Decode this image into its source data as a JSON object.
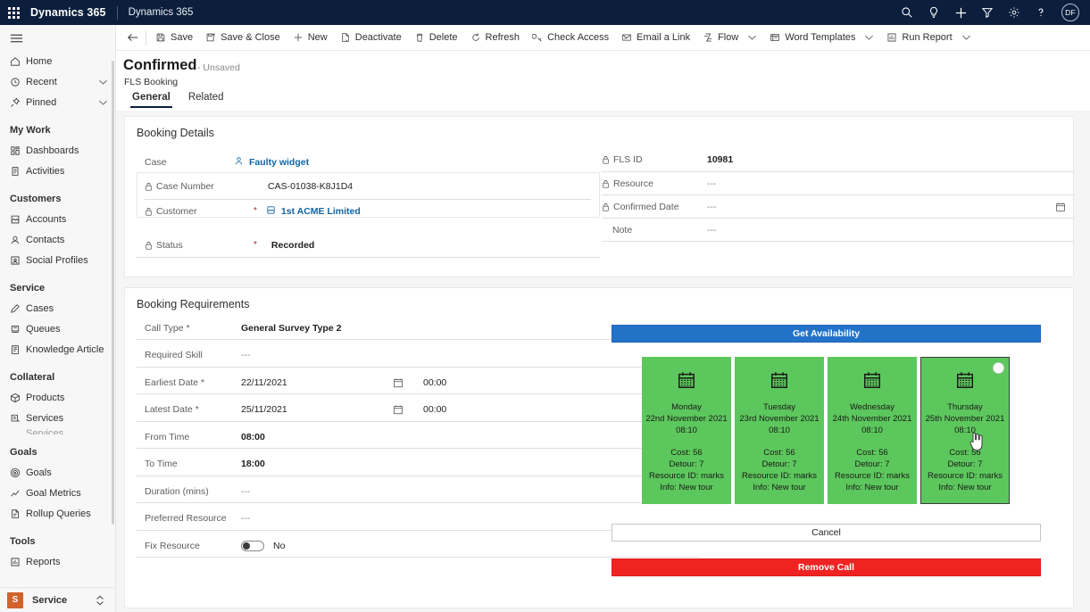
{
  "appbar": {
    "waffle": "app-launcher",
    "brand": "Dynamics 365",
    "app_name": "Dynamics 365",
    "icons": [
      "search-icon",
      "lightbulb-icon",
      "plus-icon",
      "filter-icon",
      "gear-icon",
      "help-icon"
    ],
    "avatar_initials": "DF"
  },
  "sidebar": {
    "top_items": [
      {
        "label": "Home",
        "icon": "home-icon",
        "chevron": false
      },
      {
        "label": "Recent",
        "icon": "clock-icon",
        "chevron": true
      },
      {
        "label": "Pinned",
        "icon": "pin-icon",
        "chevron": true
      }
    ],
    "groups": [
      {
        "title": "My Work",
        "items": [
          {
            "label": "Dashboards",
            "icon": "dashboard-icon"
          },
          {
            "label": "Activities",
            "icon": "activities-icon"
          }
        ]
      },
      {
        "title": "Customers",
        "items": [
          {
            "label": "Accounts",
            "icon": "account-icon"
          },
          {
            "label": "Contacts",
            "icon": "contact-icon"
          },
          {
            "label": "Social Profiles",
            "icon": "social-profile-icon"
          }
        ]
      },
      {
        "title": "Service",
        "items": [
          {
            "label": "Cases",
            "icon": "case-icon"
          },
          {
            "label": "Queues",
            "icon": "queue-icon"
          },
          {
            "label": "Knowledge Article",
            "icon": "knowledge-article-icon"
          }
        ]
      },
      {
        "title": "Collateral",
        "items": [
          {
            "label": "Products",
            "icon": "product-icon"
          },
          {
            "label": "Services",
            "icon": "service-icon"
          }
        ]
      },
      {
        "title": "Goals",
        "items": [
          {
            "label": "Goals",
            "icon": "goal-icon"
          },
          {
            "label": "Goal Metrics",
            "icon": "goal-metrics-icon"
          },
          {
            "label": "Rollup Queries",
            "icon": "rollup-queries-icon"
          }
        ]
      },
      {
        "title": "Tools",
        "items": [
          {
            "label": "Reports",
            "icon": "reports-icon"
          }
        ]
      }
    ],
    "footer": {
      "badge": "S",
      "label": "Service"
    }
  },
  "commandbar": {
    "back": "back-arrow-icon",
    "buttons": [
      {
        "label": "Save",
        "icon": "save-icon",
        "caret": false
      },
      {
        "label": "Save & Close",
        "icon": "save-close-icon",
        "caret": false
      },
      {
        "label": "New",
        "icon": "plus-icon",
        "caret": false
      },
      {
        "label": "Deactivate",
        "icon": "deactivate-icon",
        "caret": false
      },
      {
        "label": "Delete",
        "icon": "trash-icon",
        "caret": false
      },
      {
        "label": "Refresh",
        "icon": "refresh-icon",
        "caret": false
      },
      {
        "label": "Check Access",
        "icon": "check-access-icon",
        "caret": false
      },
      {
        "label": "Email a Link",
        "icon": "email-link-icon",
        "caret": false
      },
      {
        "label": "Flow",
        "icon": "flow-icon",
        "caret": true
      },
      {
        "label": "Word Templates",
        "icon": "word-templates-icon",
        "caret": true
      },
      {
        "label": "Run Report",
        "icon": "run-report-icon",
        "caret": true
      }
    ]
  },
  "record": {
    "title": "Confirmed",
    "unsaved": "- Unsaved",
    "entity": "FLS Booking",
    "tabs": [
      {
        "label": "General",
        "active": true
      },
      {
        "label": "Related",
        "active": false
      }
    ]
  },
  "booking_details": {
    "title": "Booking Details",
    "left": [
      {
        "label": "Case",
        "value": "Faulty widget",
        "type": "lookup",
        "icon": "case-lookup-icon",
        "locked": false,
        "required": false
      },
      {
        "label": "Case Number",
        "value": "CAS-01038-K8J1D4",
        "type": "text",
        "locked": true,
        "required": false
      },
      {
        "label": "Customer",
        "value": "1st ACME Limited",
        "type": "lookup",
        "icon": "account-lookup-icon",
        "locked": true,
        "required": true
      },
      {
        "label": "Status",
        "value": "Recorded",
        "type": "text-bold",
        "locked": true,
        "required": true
      }
    ],
    "right": [
      {
        "label": "FLS ID",
        "value": "10981",
        "type": "text-bold",
        "locked": true,
        "required": false
      },
      {
        "label": "Resource",
        "value": "---",
        "type": "dim",
        "locked": true,
        "required": false
      },
      {
        "label": "Confirmed Date",
        "value": "---",
        "type": "dim",
        "locked": true,
        "required": false,
        "calendar": true
      },
      {
        "label": "Note",
        "value": "---",
        "type": "dim",
        "locked": false,
        "required": false
      }
    ]
  },
  "booking_requirements": {
    "title": "Booking Requirements",
    "fields": [
      {
        "label": "Call Type",
        "required": true,
        "value": "General Survey Type 2",
        "bold": true
      },
      {
        "label": "Required Skill",
        "required": false,
        "value": "---",
        "dim": true
      },
      {
        "label": "Earliest Date",
        "required": true,
        "value": "22/11/2021",
        "time": "00:00",
        "calendar": true,
        "clock": true
      },
      {
        "label": "Latest Date",
        "required": true,
        "value": "25/11/2021",
        "time": "00:00",
        "calendar": true,
        "clock": true
      },
      {
        "label": "From Time",
        "required": false,
        "value": "08:00",
        "bold": true
      },
      {
        "label": "To Time",
        "required": false,
        "value": "18:00",
        "bold": true
      },
      {
        "label": "Duration (mins)",
        "required": false,
        "value": "---",
        "dim": true
      },
      {
        "label": "Preferred Resource",
        "required": false,
        "value": "---",
        "dim": true
      },
      {
        "label": "Fix Resource",
        "required": false,
        "value": "No",
        "toggle": true,
        "toggle_on": false
      }
    ]
  },
  "availability": {
    "get_availability_label": "Get Availability",
    "cancel_label": "Cancel",
    "remove_call_label": "Remove Call",
    "accent_blue": "#2272c8",
    "slot_green": "#5cc75c",
    "danger_red": "#f02323",
    "slots": [
      {
        "day": "Monday",
        "date": "22nd November 2021",
        "time": "08:10",
        "cost": "Cost: 56",
        "detour": "Detour: 7",
        "resource_id": "Resource ID: marks",
        "info": "Info: New tour",
        "selected": false
      },
      {
        "day": "Tuesday",
        "date": "23rd November 2021",
        "time": "08:10",
        "cost": "Cost: 56",
        "detour": "Detour: 7",
        "resource_id": "Resource ID: marks",
        "info": "Info: New tour",
        "selected": false
      },
      {
        "day": "Wednesday",
        "date": "24th November 2021",
        "time": "08:10",
        "cost": "Cost: 56",
        "detour": "Detour: 7",
        "resource_id": "Resource ID: marks",
        "info": "Info: New tour",
        "selected": false
      },
      {
        "day": "Thursday",
        "date": "25th November 2021",
        "time": "08:10",
        "cost": "Cost: 56",
        "detour": "Detour: 7",
        "resource_id": "Resource ID: marks",
        "info": "Info: New tour",
        "selected": true
      }
    ]
  }
}
